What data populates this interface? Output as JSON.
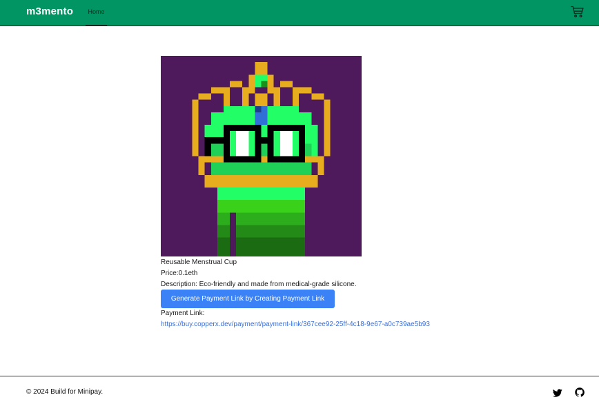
{
  "navbar": {
    "brand": "m3mento",
    "home_label": "Home",
    "cart_icon": "cart-icon",
    "background_color": "#009562"
  },
  "product": {
    "image_icon": "pixel-art-crowned-frog-nft",
    "name": "Reusable Menstrual Cup",
    "price_label": "Price:",
    "price_value": "0.1eth",
    "description_label": "Description:",
    "description_value": "Eco-friendly and made from medical-grade silicone."
  },
  "payment": {
    "button_label": "Generate Payment Link by Creating Payment Link",
    "button_color": "#3b82f6",
    "link_label": "Payment Link:",
    "link_url": "https://buy.copperx.dev/payment/payment-link/367cee92-25ff-4c18-9e67-a0c739ae5b93"
  },
  "footer": {
    "copyright": "© 2024 Build for Minipay.",
    "icons": [
      "twitter-icon",
      "github-icon"
    ]
  }
}
